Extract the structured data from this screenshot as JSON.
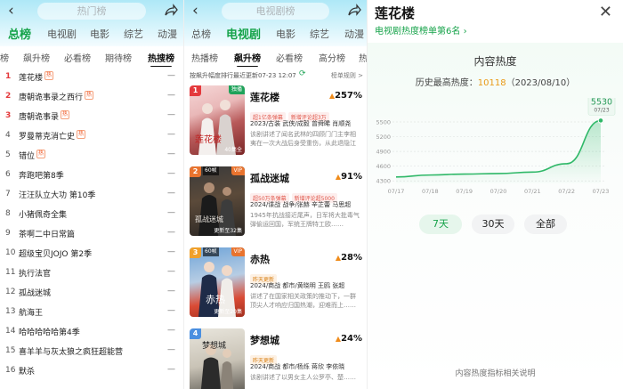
{
  "p1": {
    "title_blurred": "热门榜",
    "cats": [
      "总榜",
      "电视剧",
      "电影",
      "综艺",
      "动漫"
    ],
    "subs": [
      "榜",
      "飙升榜",
      "必看榜",
      "期待榜",
      "热搜榜"
    ],
    "items": [
      {
        "rank": "1",
        "name": "莲花楼",
        "hot": true
      },
      {
        "rank": "2",
        "name": "唐朝诡事录之西行",
        "hot": true
      },
      {
        "rank": "3",
        "name": "唐朝诡事录",
        "hot": true
      },
      {
        "rank": "4",
        "name": "罗曼蒂克消亡史",
        "hot": true
      },
      {
        "rank": "5",
        "name": "错位",
        "hot": true
      },
      {
        "rank": "6",
        "name": "奔跑吧第8季",
        "hot": false
      },
      {
        "rank": "7",
        "name": "汪汪队立大功 第10季",
        "hot": false
      },
      {
        "rank": "8",
        "name": "小猪佩奇全集",
        "hot": false
      },
      {
        "rank": "9",
        "name": "茶啊二中日常篇",
        "hot": false
      },
      {
        "rank": "10",
        "name": "超级宝贝JOJO 第2季",
        "hot": false
      },
      {
        "rank": "11",
        "name": "执行法官",
        "hot": false
      },
      {
        "rank": "12",
        "name": "孤战迷城",
        "hot": false
      },
      {
        "rank": "13",
        "name": "航海王",
        "hot": false
      },
      {
        "rank": "14",
        "name": "哈哈哈哈哈第4季",
        "hot": false
      },
      {
        "rank": "15",
        "name": "喜羊羊与灰太狼之疯狂超能营",
        "hot": false
      },
      {
        "rank": "16",
        "name": "默杀",
        "hot": false
      }
    ],
    "hot_label": "热",
    "dash": "—"
  },
  "p2": {
    "title_blurred": "电视剧榜",
    "cats": [
      "总榜",
      "电视剧",
      "电影",
      "综艺",
      "动漫"
    ],
    "subs": [
      "热播榜",
      "飙升榜",
      "必看榜",
      "高分榜",
      "热"
    ],
    "info": "按飙升幅度排行最近更新07-23 12:07",
    "rule": "榜单规则 >",
    "cards": [
      {
        "rank": "1",
        "title": "莲花楼",
        "pct": "257%",
        "tag": "独播",
        "chips": [
          "超1亿条弹幕",
          "新增评论超3万"
        ],
        "meta": "2023/古装 武侠/成毅 曾舜晞 肖顺尧",
        "desc": "该剧讲述了闻名武林的四顾门门主李相夷在一次大战后身受重伤，从此退隐江湖……",
        "update": "40集全",
        "vip": false
      },
      {
        "rank": "2",
        "title": "孤战迷城",
        "pct": "91%",
        "tag": "VIP",
        "chips": [
          "超50万条弹幕",
          "新增评论超5000"
        ],
        "meta": "2024/谍战 战争/张赫 辛芷蕾 马思超",
        "desc": "1945年抗战接近尾声，日军将大批毒气弹偷运回国，军统王牌特工欧……",
        "update": "更新至32集",
        "vip": true,
        "badge": "60帧"
      },
      {
        "rank": "3",
        "title": "赤热",
        "pct": "28%",
        "tag": "VIP",
        "chips": [
          "昨天更新"
        ],
        "meta": "2024/商战 都市/黄晓明 王鸥 张超",
        "desc": "讲述了在国家相关政策的推动下，一群顶尖人才响应归国热潮，迎难而上……",
        "update": "更新至20集",
        "vip": true,
        "badge": "60帧"
      },
      {
        "rank": "4",
        "title": "梦想城",
        "pct": "24%",
        "tag": "VIP",
        "chips": [
          "昨天更新"
        ],
        "meta": "2024/商战 都市/杨烁 蒋欣 李依晓",
        "desc": "该剧讲述了以男女主人公罗亭、楚……",
        "update": "",
        "vip": true,
        "badge": ""
      }
    ]
  },
  "p3": {
    "title": "莲花楼",
    "sub": "电视剧热度榜单第6名",
    "heat_title": "内容热度",
    "best_label": "历史最高热度：",
    "best_value": "10118",
    "best_date": "（2023/08/10）",
    "btn_7": "7天",
    "btn_30": "30天",
    "btn_all": "全部",
    "footnote": "内容热度指标相关说明",
    "tooltip_value": "5530",
    "tooltip_date": "07/23"
  },
  "chart_data": {
    "type": "area",
    "title": "内容热度",
    "x": [
      "07/17",
      "07/18",
      "07/19",
      "07/20",
      "07/21",
      "07/22",
      "07/23"
    ],
    "values": [
      4380,
      4420,
      4440,
      4450,
      4480,
      4650,
      5530
    ],
    "yticks": [
      4300,
      4600,
      4900,
      5200,
      5500
    ],
    "ylim": [
      4250,
      5700
    ],
    "grid": true,
    "color": "#2fb868"
  }
}
